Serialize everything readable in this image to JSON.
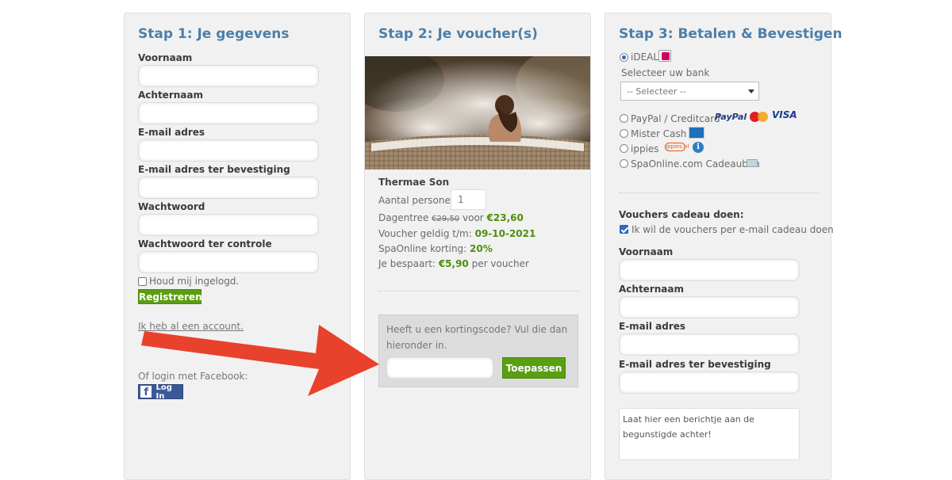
{
  "step1": {
    "title": "Stap 1: Je gegevens",
    "fields": [
      {
        "label": "Voornaam"
      },
      {
        "label": "Achternaam"
      },
      {
        "label": "E-mail adres"
      },
      {
        "label": "E-mail adres ter bevestiging"
      },
      {
        "label": "Wachtwoord"
      },
      {
        "label": "Wachtwoord ter controle"
      }
    ],
    "remember_label": "Houd mij ingelogd.",
    "register_button": "Registreren",
    "have_account_link": "Ik heb al een account.",
    "facebook_label": "Of login met Facebook:",
    "facebook_button": "Log In"
  },
  "step2": {
    "title": "Stap 2: Je voucher(s)",
    "product_name": "Thermae Son",
    "persons_label": "Aantal personen:",
    "persons_value": "1",
    "price_prefix": "Dagentree",
    "old_price": "€29,50",
    "price_mid": "voor",
    "new_price": "€23,60",
    "valid_label": "Voucher geldig t/m:",
    "valid_date": "09-10-2021",
    "discount_label": "SpaOnline korting:",
    "discount_value": "20%",
    "savings_label": "Je bespaart:",
    "savings_value": "€5,90",
    "savings_suffix": "per voucher",
    "promo_text_1": "Heeft u een kortingscode? Vul die dan",
    "promo_text_2": "hieronder in.",
    "apply_button": "Toepassen"
  },
  "step3": {
    "title": "Stap 3: Betalen & Bevestigen",
    "ideal_label": "iDEAL",
    "bank_label": "Selecteer uw bank",
    "bank_select_value": "-- Selecteer --",
    "paypal_label": "PayPal / Creditcard",
    "paypal_logo": "PayPal",
    "visa_logo": "VISA",
    "mistercash_label": "Mister Cash",
    "ippies_label": "ippies",
    "ippies_logo": "ippies.nl",
    "info_glyph": "i",
    "giftcard_label": "SpaOnline.com Cadeaubon",
    "gift_heading": "Vouchers cadeau doen:",
    "gift_checkbox_label": "Ik wil de vouchers per e-mail cadeau doen",
    "gift_fields": [
      {
        "label": "Voornaam"
      },
      {
        "label": "Achternaam"
      },
      {
        "label": "E-mail adres"
      },
      {
        "label": "E-mail adres ter bevestiging"
      }
    ],
    "message_placeholder": "Laat hier een berichtje aan de begunstigde achter!"
  },
  "colors": {
    "heading_blue": "#4d7fa8",
    "button_green": "#5a9e12",
    "arrow_red": "#e8412c"
  }
}
